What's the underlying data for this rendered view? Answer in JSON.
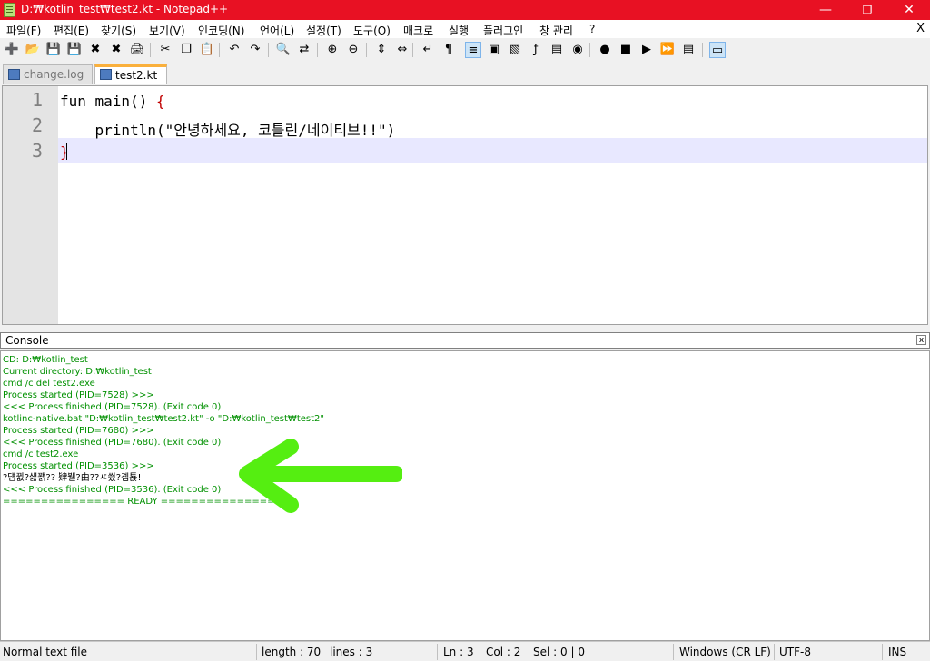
{
  "window": {
    "title": "D:₩kotlin_test₩test2.kt - Notepad++",
    "minimize": "—",
    "maximize": "❐",
    "close": "✕"
  },
  "menu": {
    "items": [
      "파일(F)",
      "편집(E)",
      "찾기(S)",
      "보기(V)",
      "인코딩(N)",
      "언어(L)",
      "설정(T)",
      "도구(O)",
      "매크로",
      "실행",
      "플러그인",
      "창 관리",
      "?"
    ],
    "close": "X"
  },
  "toolbar": {
    "icons": [
      {
        "name": "new-file-icon",
        "glyph": "➕"
      },
      {
        "name": "open-file-icon",
        "glyph": "📂"
      },
      {
        "name": "save-icon",
        "glyph": "💾"
      },
      {
        "name": "save-all-icon",
        "glyph": "💾"
      },
      {
        "name": "close-file-icon",
        "glyph": "✖"
      },
      {
        "name": "close-all-icon",
        "glyph": "✖"
      },
      {
        "name": "print-icon",
        "glyph": "🖨"
      },
      {
        "name": "cut-icon",
        "glyph": "✂"
      },
      {
        "name": "copy-icon",
        "glyph": "❐"
      },
      {
        "name": "paste-icon",
        "glyph": "📋"
      },
      {
        "name": "undo-icon",
        "glyph": "↶"
      },
      {
        "name": "redo-icon",
        "glyph": "↷"
      },
      {
        "name": "find-icon",
        "glyph": "🔍"
      },
      {
        "name": "replace-icon",
        "glyph": "⇄"
      },
      {
        "name": "zoom-in-icon",
        "glyph": "⊕"
      },
      {
        "name": "zoom-out-icon",
        "glyph": "⊖"
      },
      {
        "name": "sync-vertical-icon",
        "glyph": "⇕"
      },
      {
        "name": "sync-horizontal-icon",
        "glyph": "⇔"
      },
      {
        "name": "word-wrap-icon",
        "glyph": "↵"
      },
      {
        "name": "show-all-chars-icon",
        "glyph": "¶"
      },
      {
        "name": "indent-guide-icon",
        "glyph": "≡"
      },
      {
        "name": "user-language-icon",
        "glyph": "▣"
      },
      {
        "name": "document-map-icon",
        "glyph": "▧"
      },
      {
        "name": "function-list-icon",
        "glyph": "ƒ"
      },
      {
        "name": "folder-workspace-icon",
        "glyph": "▤"
      },
      {
        "name": "monitoring-icon",
        "glyph": "◉"
      },
      {
        "name": "record-macro-icon",
        "glyph": "●"
      },
      {
        "name": "stop-macro-icon",
        "glyph": "■"
      },
      {
        "name": "play-macro-icon",
        "glyph": "▶"
      },
      {
        "name": "play-macro-multiple-icon",
        "glyph": "⏩"
      },
      {
        "name": "save-macro-icon",
        "glyph": "▤"
      },
      {
        "name": "console-icon",
        "glyph": "▭"
      }
    ]
  },
  "tabs": [
    {
      "label": "change.log",
      "active": false
    },
    {
      "label": "test2.kt",
      "active": true
    }
  ],
  "editor": {
    "line_numbers": [
      "1",
      "2",
      "3"
    ],
    "lines": [
      {
        "code": "fun main() ",
        "brace": "{"
      },
      {
        "code": "    println(\"안녕하세요, 코틀린/네이티브!!\")",
        "brace": ""
      },
      {
        "code": "",
        "brace": "}"
      }
    ]
  },
  "console": {
    "title": "Console",
    "close": "x",
    "lines": [
      {
        "text": "CD: D:₩kotlin_test",
        "kind": "info"
      },
      {
        "text": "Current directory: D:₩kotlin_test",
        "kind": "info"
      },
      {
        "text": "cmd /c del test2.exe",
        "kind": "info"
      },
      {
        "text": "Process started (PID=7528) >>>",
        "kind": "info"
      },
      {
        "text": "<<< Process finished (PID=7528). (Exit code 0)",
        "kind": "info"
      },
      {
        "text": "kotlinc-native.bat \"D:₩kotlin_test₩test2.kt\" -o \"D:₩kotlin_test₩test2\"",
        "kind": "info"
      },
      {
        "text": "Process started (PID=7680) >>>",
        "kind": "info"
      },
      {
        "text": "<<< Process finished (PID=7680). (Exit code 0)",
        "kind": "info"
      },
      {
        "text": "cmd /c test2.exe",
        "kind": "info"
      },
      {
        "text": "Process started (PID=3536) >>>",
        "kind": "info"
      },
      {
        "text": "?덈뀞?섏꽭?? 肄뷀?由??ㅼ씠?곕툕!!",
        "kind": "stdout"
      },
      {
        "text": "<<< Process finished (PID=3536). (Exit code 0)",
        "kind": "info"
      },
      {
        "text": "================ READY ================",
        "kind": "info"
      }
    ]
  },
  "annotation": {
    "color": "#55ee11"
  },
  "status": {
    "file_type": "Normal text file",
    "length": "length : 70",
    "lines": "lines : 3",
    "ln": "Ln : 3",
    "col": "Col : 2",
    "sel": "Sel : 0 | 0",
    "eol": "Windows (CR LF)",
    "encoding": "UTF-8",
    "mode": "INS"
  }
}
